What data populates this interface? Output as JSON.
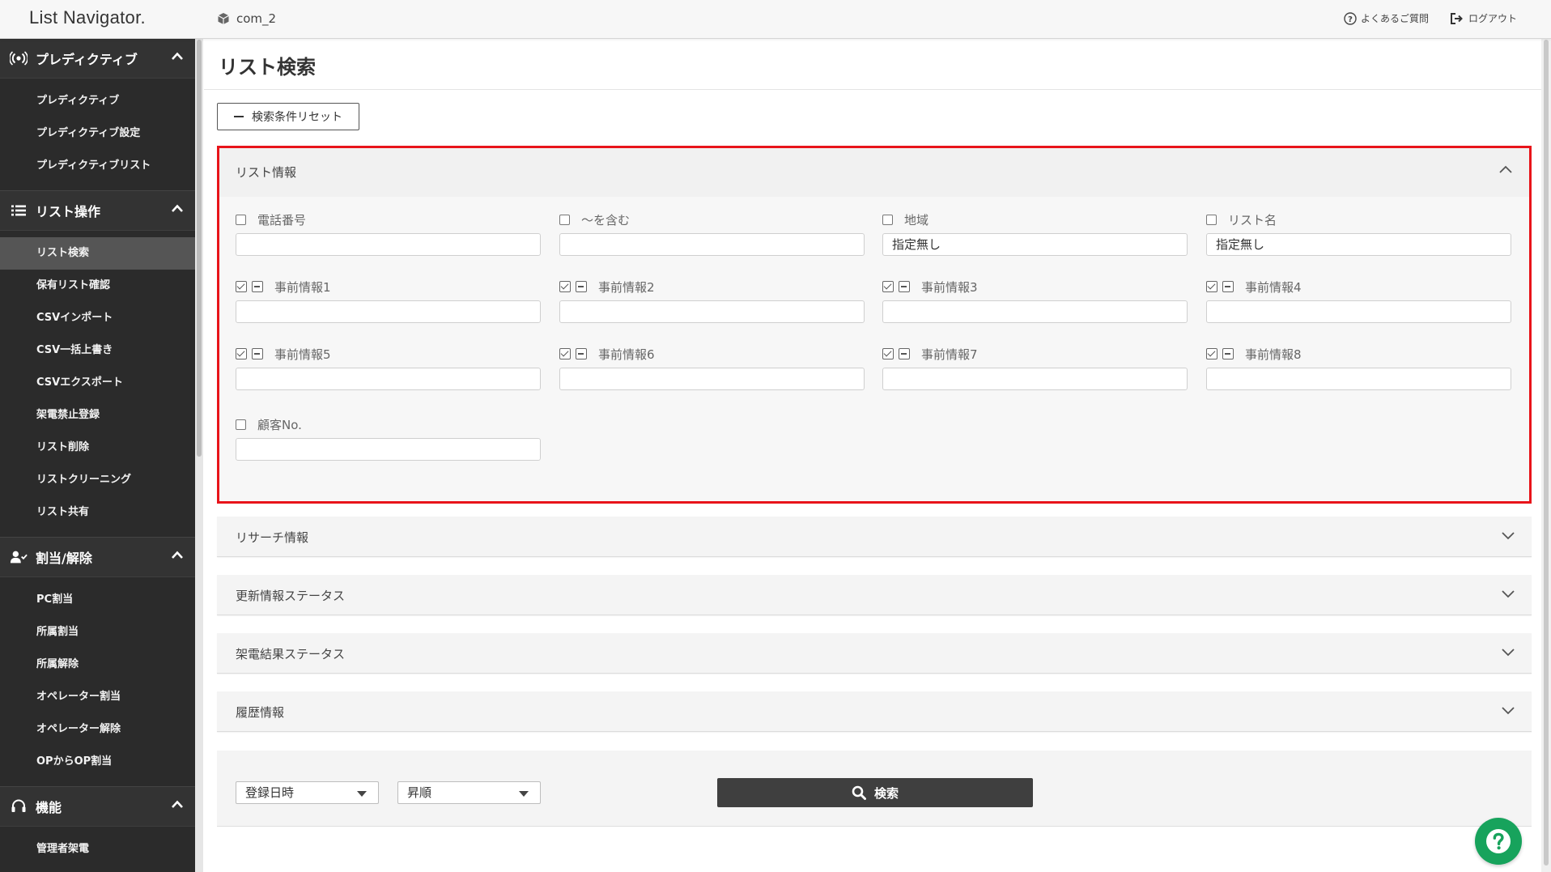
{
  "header": {
    "brand": "List Navigator.",
    "company": "com_2",
    "faq_label": "よくあるご質問",
    "logout_label": "ログアウト"
  },
  "sidebar": {
    "sections": [
      {
        "title": "プレディクティブ",
        "items": [
          "プレディクティブ",
          "プレディクティブ設定",
          "プレディクティブリスト"
        ]
      },
      {
        "title": "リスト操作",
        "items": [
          "リスト検索",
          "保有リスト確認",
          "CSVインポート",
          "CSV一括上書き",
          "CSVエクスポート",
          "架電禁止登録",
          "リスト削除",
          "リストクリーニング",
          "リスト共有"
        ]
      },
      {
        "title": "割当/解除",
        "items": [
          "PC割当",
          "所属割当",
          "所属解除",
          "オペレーター割当",
          "オペレーター解除",
          "OPからOP割当"
        ]
      },
      {
        "title": "機能",
        "items": [
          "管理者架電"
        ]
      }
    ],
    "active_item": "リスト検索"
  },
  "main": {
    "page_title": "リスト検索",
    "reset_label": "検索条件リセット",
    "list_info": {
      "title": "リスト情報",
      "fields": {
        "phone": {
          "label": "電話番号",
          "value": ""
        },
        "contains": {
          "label": "〜を含む",
          "value": ""
        },
        "region": {
          "label": "地域",
          "value": "指定無し"
        },
        "list_name": {
          "label": "リスト名",
          "value": "指定無し"
        },
        "pre1": {
          "label": "事前情報1",
          "value": ""
        },
        "pre2": {
          "label": "事前情報2",
          "value": ""
        },
        "pre3": {
          "label": "事前情報3",
          "value": ""
        },
        "pre4": {
          "label": "事前情報4",
          "value": ""
        },
        "pre5": {
          "label": "事前情報5",
          "value": ""
        },
        "pre6": {
          "label": "事前情報6",
          "value": ""
        },
        "pre7": {
          "label": "事前情報7",
          "value": ""
        },
        "pre8": {
          "label": "事前情報8",
          "value": ""
        },
        "customer_no": {
          "label": "顧客No.",
          "value": ""
        }
      }
    },
    "collapsed_sections": [
      "リサーチ情報",
      "更新情報ステータス",
      "架電結果ステータス",
      "履歴情報"
    ],
    "sort_field": "登録日時",
    "sort_order": "昇順",
    "search_label": "検索"
  },
  "colors": {
    "highlight_border": "#e8141a",
    "sidebar_bg": "#2b2b2b",
    "help_fab": "#17a35c"
  }
}
